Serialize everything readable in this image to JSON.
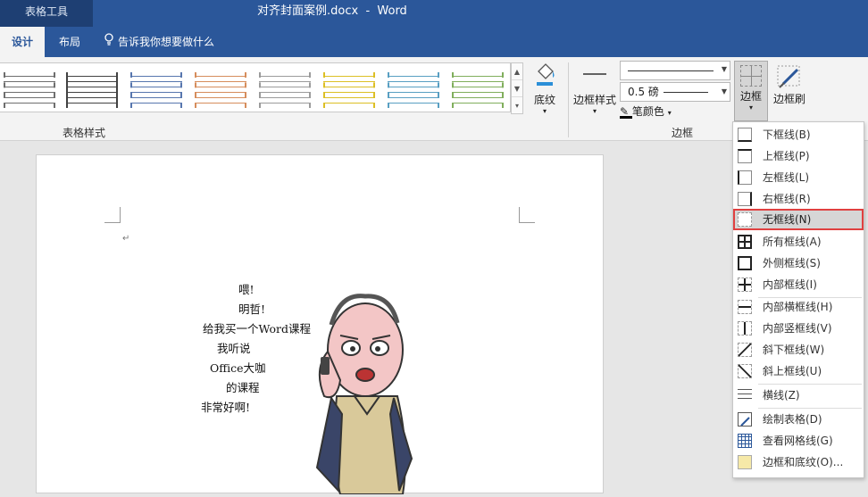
{
  "titlebar": {
    "context_tab": "表格工具",
    "title": "对齐封面案例.docx  -  Word"
  },
  "tabs": {
    "design": "设计",
    "layout": "布局",
    "tell_me": "告诉我你想要做什么"
  },
  "ribbon": {
    "table_styles_label": "表格样式",
    "shading_label": "底纹",
    "border_styles_label": "边框样式",
    "line_weight": "0.5 磅",
    "pen_color_label": "笔颜色",
    "borders_group_label": "边框",
    "borders_button_label": "边框",
    "border_painter_label": "边框刷"
  },
  "document": {
    "lines": [
      "喂!",
      "明哲!",
      "给我买一个Word课程",
      "我听说",
      "Office大咖",
      "的课程",
      "非常好啊!"
    ]
  },
  "border_menu": {
    "items": [
      {
        "label": "下框线(B)",
        "icon": "bottom-border-icon"
      },
      {
        "label": "上框线(P)",
        "icon": "top-border-icon"
      },
      {
        "label": "左框线(L)",
        "icon": "left-border-icon"
      },
      {
        "label": "右框线(R)",
        "icon": "right-border-icon"
      },
      {
        "label": "无框线(N)",
        "icon": "no-border-icon",
        "highlighted": true
      },
      {
        "label": "所有框线(A)",
        "icon": "all-borders-icon"
      },
      {
        "label": "外侧框线(S)",
        "icon": "outside-borders-icon"
      },
      {
        "label": "内部框线(I)",
        "icon": "inside-borders-icon"
      },
      {
        "label": "内部横框线(H)",
        "icon": "inside-horizontal-border-icon"
      },
      {
        "label": "内部竖框线(V)",
        "icon": "inside-vertical-border-icon"
      },
      {
        "label": "斜下框线(W)",
        "icon": "diagonal-down-border-icon"
      },
      {
        "label": "斜上框线(U)",
        "icon": "diagonal-up-border-icon"
      },
      {
        "label": "横线(Z)",
        "icon": "horizontal-line-icon"
      },
      {
        "label": "绘制表格(D)",
        "icon": "draw-table-icon"
      },
      {
        "label": "查看网格线(G)",
        "icon": "view-gridlines-icon"
      },
      {
        "label": "边框和底纹(O)...",
        "icon": "borders-and-shading-icon"
      }
    ]
  },
  "colors": {
    "ribbon_blue": "#2b579a",
    "highlight_border": "#e04040"
  }
}
